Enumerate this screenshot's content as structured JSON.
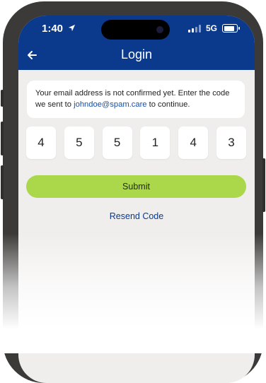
{
  "status_bar": {
    "time": "1:40",
    "network": "5G",
    "location_icon": "location-arrow-icon"
  },
  "header": {
    "title": "Login",
    "back_icon": "back-arrow-icon"
  },
  "message": {
    "text_before": "Your email address is not confirmed yet. Enter the code we sent to ",
    "email": "johndoe@spam.care",
    "text_after": " to continue."
  },
  "code_digits": [
    "4",
    "5",
    "5",
    "1",
    "4",
    "3"
  ],
  "submit_label": "Submit",
  "resend_label": "Resend Code",
  "colors": {
    "header": "#0b3a8c",
    "submit": "#abd74a",
    "background": "#efeeec",
    "link": "#0b3a8c"
  }
}
